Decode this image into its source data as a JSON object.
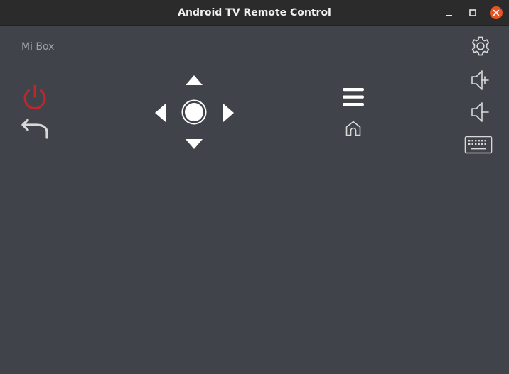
{
  "window": {
    "title": "Android TV Remote Control"
  },
  "device": {
    "name": "Mi Box"
  },
  "colors": {
    "background": "#40444a",
    "titlebar": "#2b2b2b",
    "icon": "#ffffff",
    "icon_muted": "#d8d8d8",
    "power": "#c0262d",
    "close_button": "#e95420"
  },
  "icons": {
    "power": "power-icon",
    "back": "back-arrow-icon",
    "up": "dpad-up-icon",
    "down": "dpad-down-icon",
    "left": "dpad-left-icon",
    "right": "dpad-right-icon",
    "ok": "dpad-ok-icon",
    "menu": "hamburger-menu-icon",
    "home": "home-icon",
    "settings": "gear-icon",
    "volume_up": "volume-up-icon",
    "volume_down": "volume-down-icon",
    "keyboard": "keyboard-icon"
  }
}
